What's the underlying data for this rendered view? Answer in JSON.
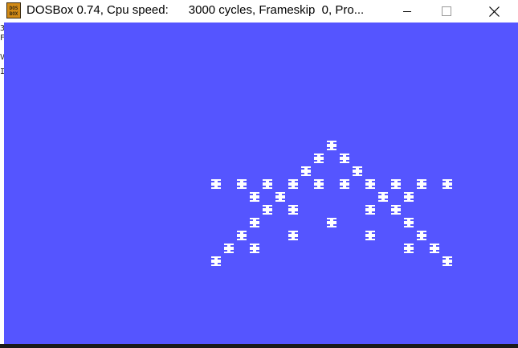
{
  "window": {
    "title": "DOSBox 0.74, Cpu speed:      3000 cycles, Frameskip  0, Pro...",
    "icon": "dosbox-app-icon",
    "buttons": {
      "minimize_icon": "minimize-icon",
      "maximize_icon": "maximize-icon",
      "close_icon": "close-icon"
    }
  },
  "colors": {
    "dos_background": "#5555ff",
    "glyph": "#ffffff",
    "titlebar": "#ffffff",
    "title_text": "#000000"
  },
  "screen": {
    "glyph": "star-asterisk-glyph",
    "text_grid": {
      "columns": 40,
      "rows": 25
    },
    "stars": [
      [
        9,
        25
      ],
      [
        10,
        24
      ],
      [
        10,
        26
      ],
      [
        11,
        23
      ],
      [
        11,
        27
      ],
      [
        12,
        16
      ],
      [
        12,
        18
      ],
      [
        12,
        20
      ],
      [
        12,
        22
      ],
      [
        12,
        24
      ],
      [
        12,
        26
      ],
      [
        12,
        28
      ],
      [
        12,
        30
      ],
      [
        12,
        32
      ],
      [
        12,
        34
      ],
      [
        13,
        19
      ],
      [
        13,
        21
      ],
      [
        13,
        29
      ],
      [
        13,
        31
      ],
      [
        14,
        20
      ],
      [
        14,
        22
      ],
      [
        14,
        28
      ],
      [
        14,
        30
      ],
      [
        15,
        19
      ],
      [
        15,
        25
      ],
      [
        15,
        31
      ],
      [
        16,
        18
      ],
      [
        16,
        22
      ],
      [
        16,
        28
      ],
      [
        16,
        32
      ],
      [
        17,
        17
      ],
      [
        17,
        19
      ],
      [
        17,
        31
      ],
      [
        17,
        33
      ],
      [
        18,
        16
      ],
      [
        18,
        34
      ]
    ]
  }
}
